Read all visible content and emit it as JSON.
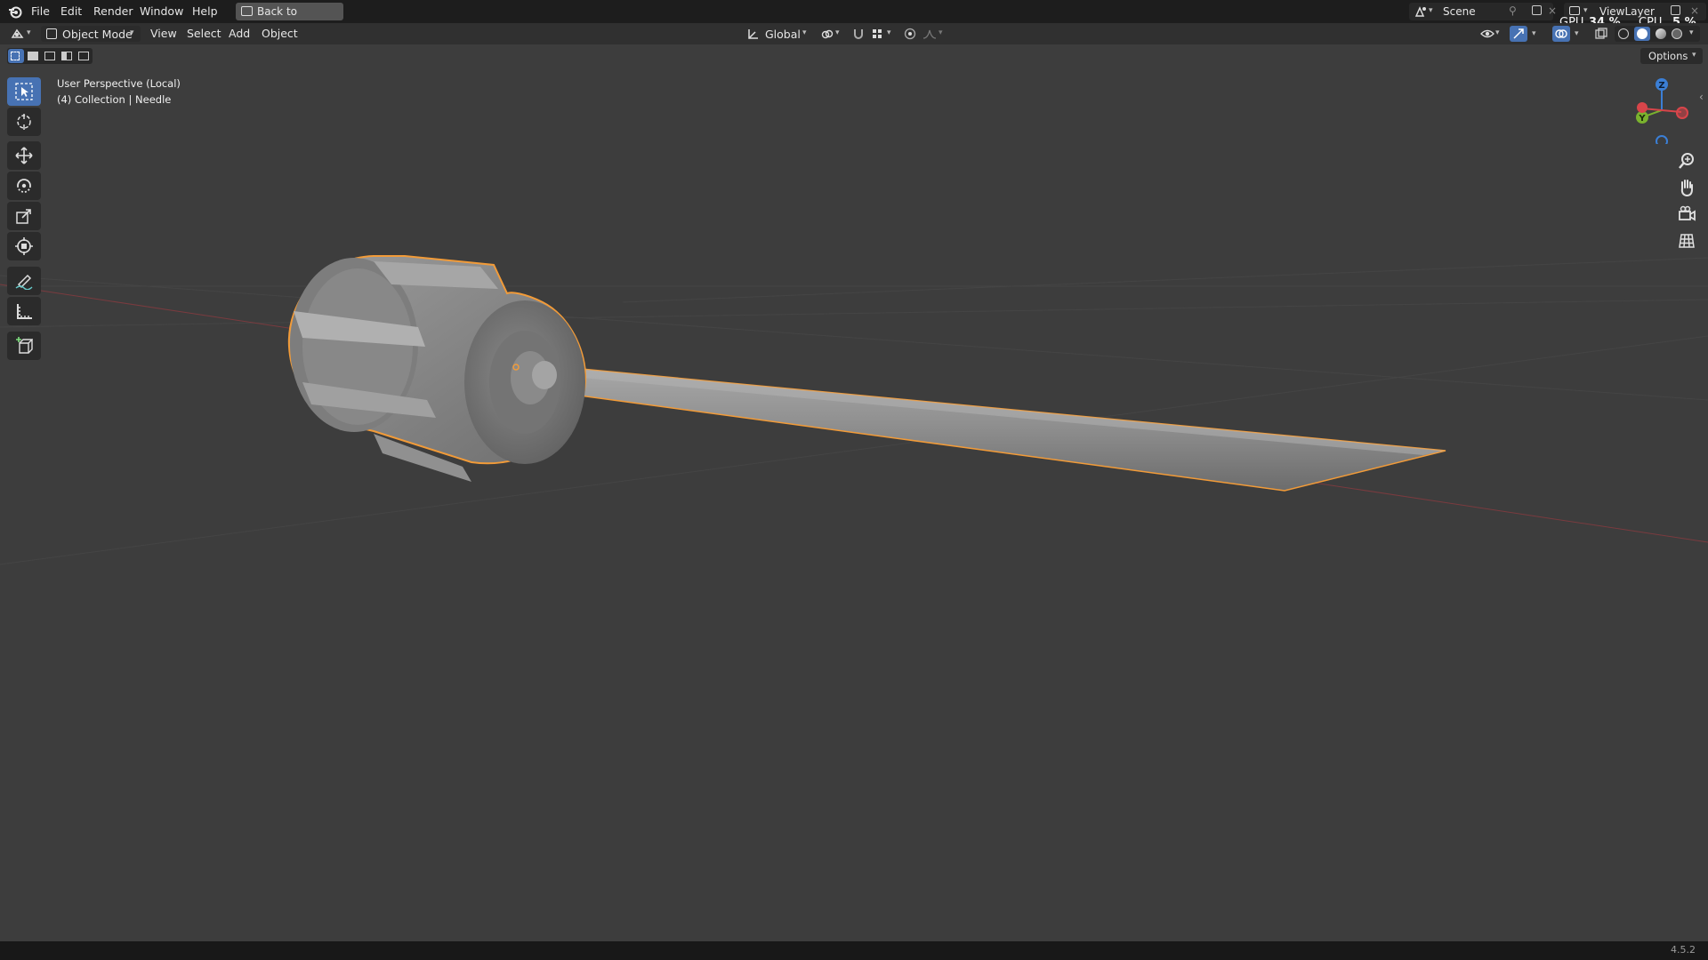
{
  "menu": {
    "file": "File",
    "edit": "Edit",
    "render": "Render",
    "window": "Window",
    "help": "Help",
    "back_to_previous": "Back to Previous"
  },
  "topright": {
    "scene": "Scene",
    "view_layer": "ViewLayer",
    "gpu_label": "GPU",
    "gpu_value": "34 %",
    "cpu_label": "CPU",
    "cpu_value": "5 %"
  },
  "header": {
    "mode": "Object Mode",
    "view": "View",
    "select": "Select",
    "add": "Add",
    "object": "Object",
    "orientation": "Global",
    "options": "Options"
  },
  "viewport": {
    "perspective": "User Perspective (Local)",
    "collection": "(4) Collection | Needle"
  },
  "gizmo": {
    "z": "Z",
    "y": "Y"
  },
  "status": {
    "version": "4.5.2"
  },
  "colors": {
    "selection_outline": "#f29b38",
    "active_tool": "#4772b3",
    "axis_x": "#d8454a",
    "axis_y": "#7ab22e",
    "axis_z": "#3b7fd6"
  }
}
